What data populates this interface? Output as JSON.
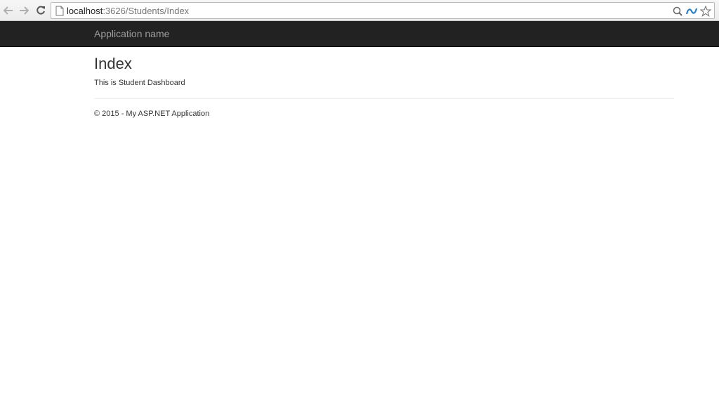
{
  "browser": {
    "url_host": "localhost",
    "url_path": ":3626/Students/Index",
    "icons": {
      "back": "back-arrow-icon",
      "forward": "forward-arrow-icon",
      "reload": "reload-icon",
      "page": "page-icon",
      "zoom": "magnifier-icon",
      "extension": "extension-icon",
      "bookmark": "star-icon"
    }
  },
  "navbar": {
    "brand": "Application name",
    "background": "#222222",
    "brand_color": "#9d9d9d"
  },
  "main": {
    "title": "Index",
    "text": "This is Student Dashboard"
  },
  "footer": {
    "text": "© 2015 - My ASP.NET Application"
  }
}
